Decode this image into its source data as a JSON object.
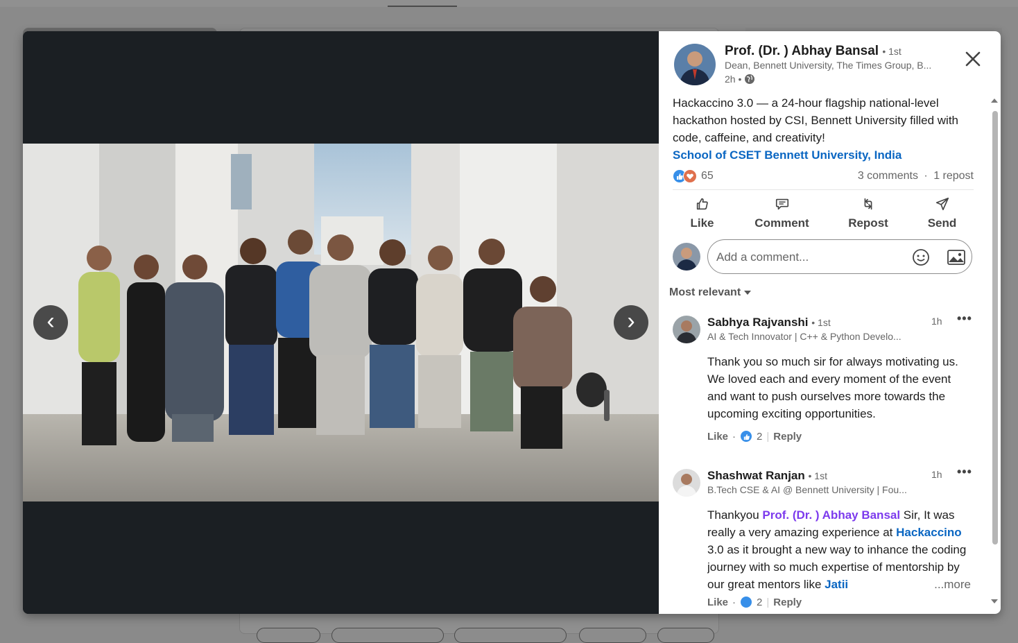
{
  "post": {
    "author": {
      "name": "Prof. (Dr. ) Abhay Bansal",
      "degree": "• 1st",
      "headline": "Dean, Bennett University, The Times Group, B...",
      "time": "2h •"
    },
    "text": "Hackaccino 3.0 — a 24-hour flagship national-level hackathon hosted by CSI, Bennett University filled with code, caffeine, and creativity!",
    "link": "School of CSET Bennett University, India",
    "reaction_count": "65",
    "comments_count": "3 comments",
    "reposts_count": "1 repost",
    "separator": "·",
    "actions": {
      "like": "Like",
      "comment": "Comment",
      "repost": "Repost",
      "send": "Send"
    }
  },
  "comment_input": {
    "placeholder": "Add a comment..."
  },
  "sort_label": "Most relevant",
  "comments": [
    {
      "name": "Sabhya Rajvanshi",
      "degree": "• 1st",
      "headline": "AI & Tech Innovator | C++ & Python Develo...",
      "time": "1h",
      "more": "•••",
      "body": "Thank you so much sir for always motivating us. We loved each and every moment of the event and want to push ourselves more towards the upcoming exciting opportunities.",
      "like_label": "Like",
      "dot": "·",
      "likes": "2",
      "reply_label": "Reply"
    },
    {
      "name": "Shashwat Ranjan",
      "degree": "• 1st",
      "headline": "B.Tech CSE & AI @ Bennett University | Fou...",
      "time": "1h",
      "more": "•••",
      "body_start": "Thankyou ",
      "mention": "Prof. (Dr. ) Abhay Bansal",
      "body_mid": " Sir, It was really a very amazing experience at ",
      "hashtag": "Hackaccino",
      "body_end": " 3.0 as it brought a new way to inhance the coding journey with so much expertise of mentorship by our great mentors like ",
      "trailing_link": "Jatii",
      "see_more": "...more",
      "like_label": "Like",
      "dot": "·",
      "likes": "2",
      "reply_label": "Reply"
    }
  ],
  "colors": {
    "link_blue": "#0a66c2",
    "mention_purple": "#7c3aed",
    "modal_dark": "#1b1f23"
  },
  "icons": [
    "close-icon",
    "globe-icon",
    "like-icon",
    "comment-icon",
    "repost-icon",
    "send-icon",
    "emoji-icon",
    "image-icon",
    "caret-down-icon",
    "more-icon",
    "chevron-left-icon",
    "chevron-right-icon"
  ]
}
